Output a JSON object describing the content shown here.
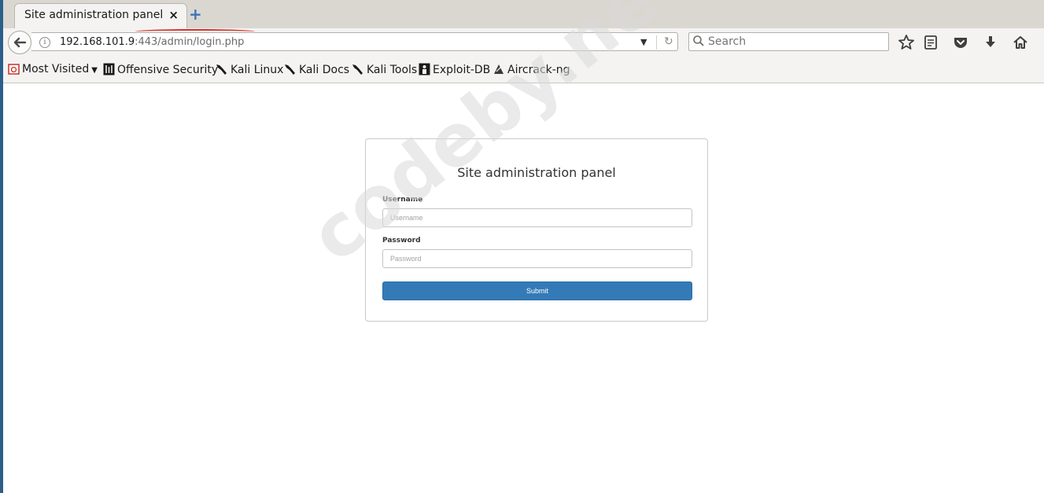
{
  "browser": {
    "tab": {
      "title": "Site administration panel",
      "close": "×"
    },
    "new_tab": "+",
    "url": {
      "host": "192.168.101.9",
      "rest": ":443/admin/login.php"
    },
    "search": {
      "placeholder": "Search"
    },
    "toolbar_icons": [
      "star-icon",
      "reading-list-icon",
      "pocket-icon",
      "download-icon",
      "home-icon"
    ],
    "bookmarks": [
      {
        "label": "Most Visited",
        "icon": "most-visited-icon"
      },
      {
        "label": "Offensive Security",
        "icon": "offsec-icon"
      },
      {
        "label": "Kali Linux",
        "icon": "kali-icon"
      },
      {
        "label": "Kali Docs",
        "icon": "kali-icon"
      },
      {
        "label": "Kali Tools",
        "icon": "kali-icon"
      },
      {
        "label": "Exploit-DB",
        "icon": "exploitdb-icon"
      },
      {
        "label": "Aircrack-ng",
        "icon": "aircrack-icon"
      }
    ]
  },
  "page": {
    "title": "Site administration panel",
    "username_label": "Username",
    "username_placeholder": "Username",
    "password_label": "Password",
    "password_placeholder": "Password",
    "submit_label": "Submit",
    "primary_color": "#337ab7"
  },
  "watermark": "codeby.net"
}
